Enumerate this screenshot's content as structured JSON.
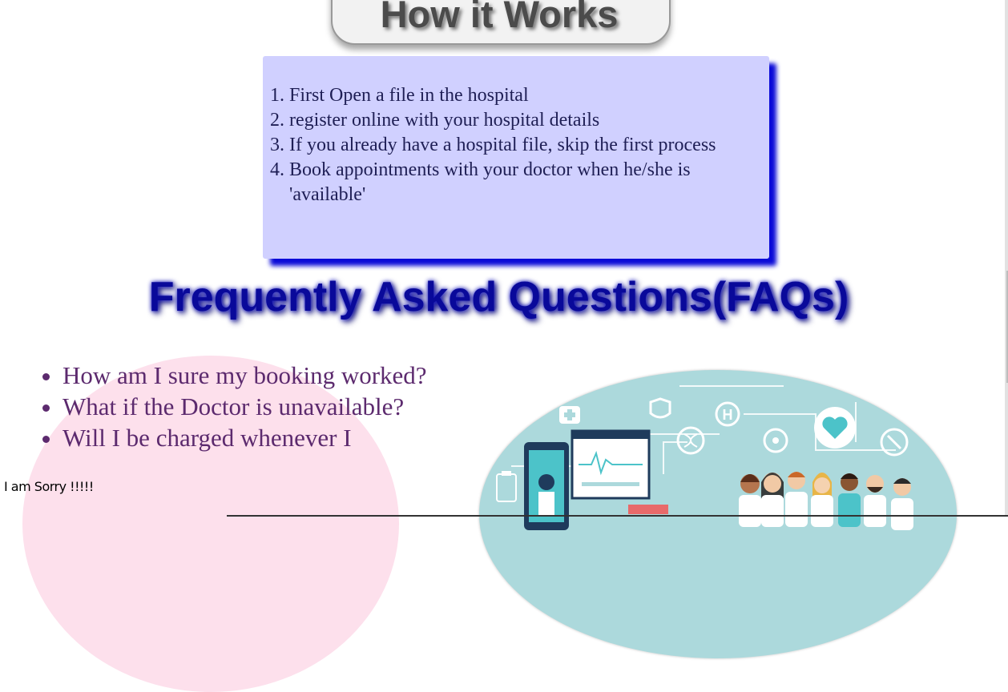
{
  "how_it_works": {
    "title": "How it Works",
    "steps": [
      "First Open a file in the hospital",
      "register online with your hospital details",
      "If you already have a hospital file, skip the first process",
      "Book appointments with your doctor when he/she is 'available'"
    ]
  },
  "faqs": {
    "title": "Frequently Asked Questions(FAQs)",
    "questions": [
      "How am I sure my booking worked?",
      "What if the Doctor is unavailable?",
      "Will I be charged whenever I"
    ]
  },
  "overlay_message": "I am Sorry !!!!!",
  "colors": {
    "steps_box_bg": "#d0d0ff",
    "steps_box_shadow": "#0a0ad8",
    "faq_title": "#09099a",
    "faq_text": "#5c2a6e",
    "pink_blob": "#fde0ec",
    "illustration_bg": "#acd9dc"
  },
  "illustration": {
    "icons": [
      "first-aid-icon",
      "hospital-h-icon",
      "heart-monitor-icon",
      "dna-icon",
      "pill-icon",
      "stethoscope-icon",
      "clipboard-icon",
      "shield-icon"
    ]
  }
}
